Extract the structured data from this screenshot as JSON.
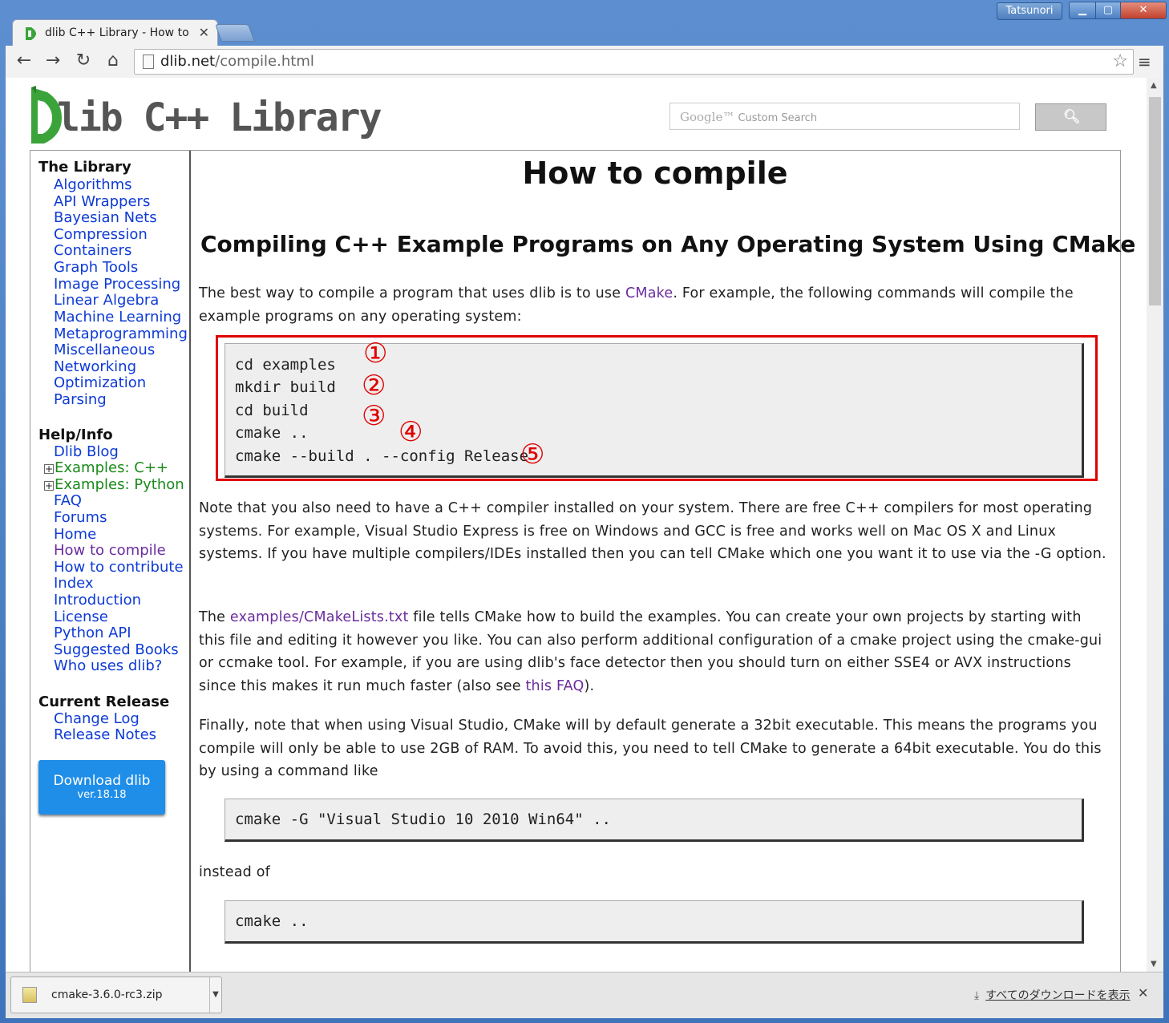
{
  "browser": {
    "user_name": "Tatsunori",
    "window_buttons": {
      "minimize": "▁",
      "maximize": "▢",
      "close": "✕"
    },
    "tab_title": "dlib C++ Library - How to",
    "tab_close": "✕",
    "url_host": "dlib.net",
    "url_path": "/compile.html",
    "nav": {
      "back": "←",
      "forward": "→",
      "reload": "↻",
      "home": "⌂",
      "star": "☆",
      "menu": "≡"
    }
  },
  "header": {
    "logo_text": "lib C++ Library",
    "search_placeholder_brand": "Google™",
    "search_placeholder": "Custom Search",
    "search_button_icon": "🔍︎"
  },
  "sidebar": {
    "library_heading": "The Library",
    "library_items": [
      "Algorithms",
      "API Wrappers",
      "Bayesian Nets",
      "Compression",
      "Containers",
      "Graph Tools",
      "Image Processing",
      "Linear Algebra",
      "Machine Learning",
      "Metaprogramming",
      "Miscellaneous",
      "Networking",
      "Optimization",
      "Parsing"
    ],
    "help_heading": "Help/Info",
    "help_items": [
      "Dlib Blog",
      "Examples: C++",
      "Examples: Python",
      "FAQ",
      "Forums",
      "Home",
      "How to compile",
      "How to contribute",
      "Index",
      "Introduction",
      "License",
      "Python API",
      "Suggested Books",
      "Who uses dlib?"
    ],
    "release_heading": "Current Release",
    "release_items": [
      "Change Log",
      "Release Notes"
    ],
    "download_label": "Download dlib",
    "download_version": "ver.18.18",
    "colors": {
      "link": "#0d3ad6",
      "visited": "#6a2c9e",
      "example": "#1a8a1a",
      "download_bg": "#1f8ee8"
    }
  },
  "content": {
    "page_title": "How to compile",
    "section_title": "Compiling C++ Example Programs on Any Operating System Using CMake",
    "p1_before": "The best way to compile a program that uses dlib is to use ",
    "p1_link": "CMake",
    "p1_after": ". For example, the following commands will compile the example programs on any operating system:",
    "code_lines": [
      "cd examples",
      "mkdir build",
      "cd build",
      "cmake ..",
      "cmake --build . --config Release"
    ],
    "markers": [
      "①",
      "②",
      "③",
      "④",
      "⑤"
    ],
    "highlight_color": "#e00000",
    "p2": "Note that you also need to have a C++ compiler installed on your system. There are free C++ compilers for most operating systems. For example, Visual Studio Express is free on Windows and GCC is free and works well on Mac OS X and Linux systems. If you have multiple compilers/IDEs installed then you can tell CMake which one you want it to use via the -G option.",
    "p3_before": "The ",
    "p3_link": "examples/CMakeLists.txt",
    "p3_middle": " file tells CMake how to build the examples. You can create your own projects by starting with this file and editing it however you like. You can also perform additional configuration of a cmake project using the cmake-gui or ccmake tool. For example, if you are using dlib's face detector then you should turn on either SSE4 or AVX instructions since this makes it run much faster (also see ",
    "p3_link2": "this FAQ",
    "p3_after": ").",
    "p4": "Finally, note that when using Visual Studio, CMake will by default generate a 32bit executable. This means the programs you compile will only be able to use 2GB of RAM. To avoid this, you need to tell CMake to generate a 64bit executable. You do this by using a command like",
    "code2": "cmake -G \"Visual Studio 10 2010 Win64\" ..",
    "instead_of": "instead of",
    "code3": "cmake .."
  },
  "download_shelf": {
    "file_name": "cmake-3.6.0-rc3.zip",
    "show_all": "すべてのダウンロードを表示",
    "close": "✕"
  }
}
